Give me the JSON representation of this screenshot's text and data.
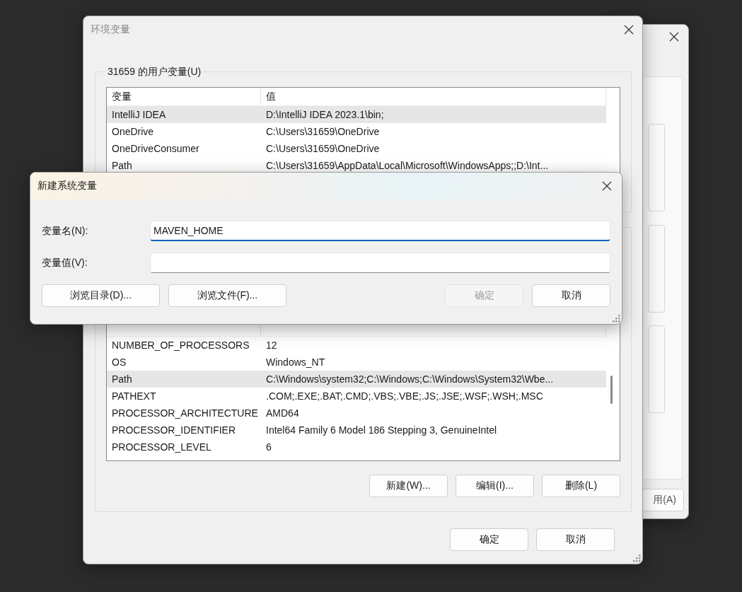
{
  "background_window": {
    "apply_button": "用(A)"
  },
  "window": {
    "title": "环境变量",
    "active": false,
    "user_variables": {
      "label": "31659 的用户变量(U)",
      "columns": [
        "变量",
        "值"
      ],
      "rows": [
        {
          "name": "IntelliJ IDEA",
          "value": "D:\\IntelliJ IDEA 2023.1\\bin;",
          "selected": true
        },
        {
          "name": "OneDrive",
          "value": "C:\\Users\\31659\\OneDrive",
          "selected": false
        },
        {
          "name": "OneDriveConsumer",
          "value": "C:\\Users\\31659\\OneDrive",
          "selected": false
        },
        {
          "name": "Path",
          "value": "C:\\Users\\31659\\AppData\\Local\\Microsoft\\WindowsApps;;D:\\Int...",
          "selected": false
        }
      ]
    },
    "system_variables": {
      "rows": [
        {
          "name": "NUMBER_OF_PROCESSORS",
          "value": "12",
          "selected": false
        },
        {
          "name": "OS",
          "value": "Windows_NT",
          "selected": false
        },
        {
          "name": "Path",
          "value": "C:\\Windows\\system32;C:\\Windows;C:\\Windows\\System32\\Wbe...",
          "selected": true
        },
        {
          "name": "PATHEXT",
          "value": ".COM;.EXE;.BAT;.CMD;.VBS;.VBE;.JS;.JSE;.WSF;.WSH;.MSC",
          "selected": false
        },
        {
          "name": "PROCESSOR_ARCHITECTURE",
          "value": "AMD64",
          "selected": false
        },
        {
          "name": "PROCESSOR_IDENTIFIER",
          "value": "Intel64 Family 6 Model 186 Stepping 3, GenuineIntel",
          "selected": false
        },
        {
          "name": "PROCESSOR_LEVEL",
          "value": "6",
          "selected": false
        }
      ],
      "buttons": [
        "新建(W)...",
        "编辑(I)...",
        "删除(L)"
      ]
    },
    "buttons": [
      "确定",
      "取消"
    ]
  },
  "dialog": {
    "title": "新建系统变量",
    "fields": [
      {
        "label": "变量名(N):",
        "value": "MAVEN_HOME",
        "focused": true
      },
      {
        "label": "变量值(V):",
        "focused": false
      }
    ],
    "browse_buttons": [
      {
        "label": "浏览目录(D)...",
        "disabled": false
      },
      {
        "label": "浏览文件(F)...",
        "disabled": false
      }
    ],
    "buttons": [
      {
        "label": "确定",
        "disabled": true
      },
      {
        "label": "取消",
        "disabled": false
      }
    ]
  }
}
